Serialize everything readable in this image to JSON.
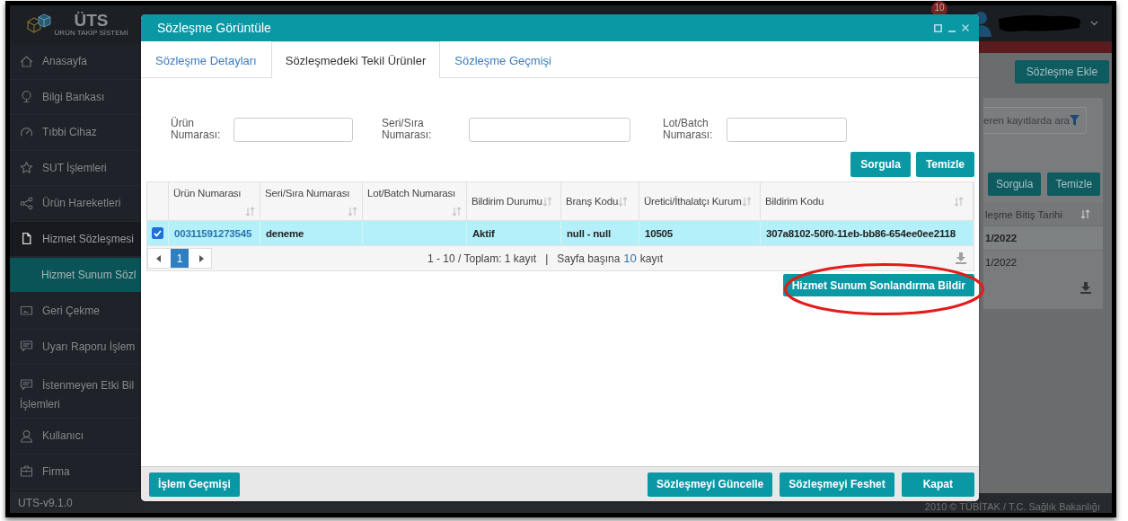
{
  "app": {
    "logo": {
      "title": "ÜTS",
      "subtitle": "ÜRÜN TAKİP SİSTEMİ"
    },
    "notification_count": "10",
    "version": "UTS-v9.1.0",
    "copyright": "2010 © TÜBİTAK / T.C. Sağlık Bakanlığı"
  },
  "sidebar": {
    "items": [
      {
        "label": "Anasayfa",
        "expanded": false,
        "selected": false
      },
      {
        "label": "Bilgi Bankası",
        "expanded": false,
        "selected": false
      },
      {
        "label": "Tıbbi Cihaz",
        "expanded": false,
        "selected": false
      },
      {
        "label": "SUT İşlemleri",
        "expanded": false,
        "selected": false
      },
      {
        "label": "Ürün Hareketleri",
        "expanded": false,
        "selected": false
      },
      {
        "label": "Hizmet Sözleşmesi",
        "expanded": true,
        "selected": false,
        "children": [
          {
            "label": "Hizmet Sunum Sözl",
            "selected": true
          }
        ]
      },
      {
        "label": "Geri Çekme",
        "expanded": false,
        "selected": false
      },
      {
        "label": "Uyarı Raporu İşlem",
        "expanded": false,
        "selected": false
      },
      {
        "label": "İstenmeyen Etki Bil İşlemleri",
        "expanded": false,
        "selected": false
      },
      {
        "label": "Kullanıcı",
        "expanded": false,
        "selected": false
      },
      {
        "label": "Firma",
        "expanded": false,
        "selected": false
      }
    ]
  },
  "background_page": {
    "add_button": "Sözleşme Ekle",
    "search_placeholder": "eren kayıtlarda ara",
    "buttons": [
      "Sorgula",
      "Temizle"
    ],
    "column": "leşme Bitiş Tarihi",
    "rows": [
      {
        "value": "1/2022",
        "selected": true
      },
      {
        "value": "1/2022",
        "selected": false
      }
    ]
  },
  "dialog": {
    "title": "Sözleşme Görüntüle",
    "tabs": [
      {
        "label": "Sözleşme Detayları",
        "selected": false
      },
      {
        "label": "Sözleşmedeki Tekil Ürünler",
        "selected": true
      },
      {
        "label": "Sözleşme Geçmişi",
        "selected": false
      }
    ],
    "filters": [
      {
        "label": "Ürün Numarası:"
      },
      {
        "label": "Seri/Sıra Numarası:"
      },
      {
        "label": "Lot/Batch Numarası:"
      }
    ],
    "filter_buttons": [
      "Sorgula",
      "Temizle"
    ],
    "table": {
      "columns": [
        "Ürün Numarası",
        "Seri/Sıra Numarası",
        "Lot/Batch Numarası",
        "Bildirim Durumu",
        "Branş Kodu",
        "Üretici/İthalatçı Kurum",
        "Bildirim Kodu"
      ],
      "rows": [
        {
          "selected": true,
          "product_number": "00311591273545",
          "serial_number": "deneme",
          "status": "Aktif",
          "branch_code": "null - null",
          "manufacturer": "10505",
          "notification_code": "307a8102-50f0-11eb-bb86-654ee0ee2118"
        }
      ]
    },
    "pager": {
      "pages": [
        {
          "label": "1",
          "selected": true
        }
      ],
      "summary": "1 - 10 / Toplam: 1 kayıt",
      "separator": "|",
      "per_page_label": "Sayfa başına",
      "per_page": "10",
      "per_page_unit": "kayıt"
    },
    "action_button": "Hizmet Sunum Sonlandırma Bildir",
    "footer_left": [
      "İşlem Geçmişi"
    ],
    "footer_right": [
      "Sözleşmeyi Güncelle",
      "Sözleşmeyi Feshet",
      "Kapat"
    ]
  }
}
